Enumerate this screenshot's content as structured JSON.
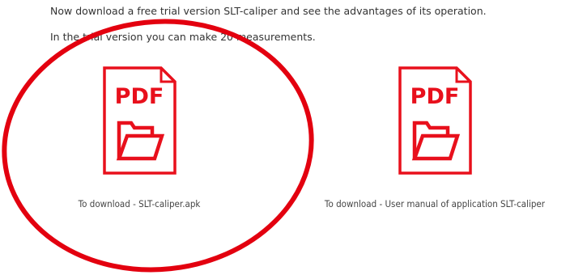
{
  "intro": {
    "line1": "Now download a free trial version SLT-caliper and see the advantages of its operation.",
    "line2": "In the trial version you can make 20 measurements."
  },
  "downloads": [
    {
      "icon": "pdf-folder-icon",
      "icon_text": "PDF",
      "caption": "To download - SLT-caliper.apk"
    },
    {
      "icon": "pdf-folder-icon",
      "icon_text": "PDF",
      "caption": "To download - User manual of application SLT-caliper"
    }
  ],
  "colors": {
    "icon_red": "#e8101c",
    "annotation_red": "#e3000f",
    "text": "#333333"
  }
}
